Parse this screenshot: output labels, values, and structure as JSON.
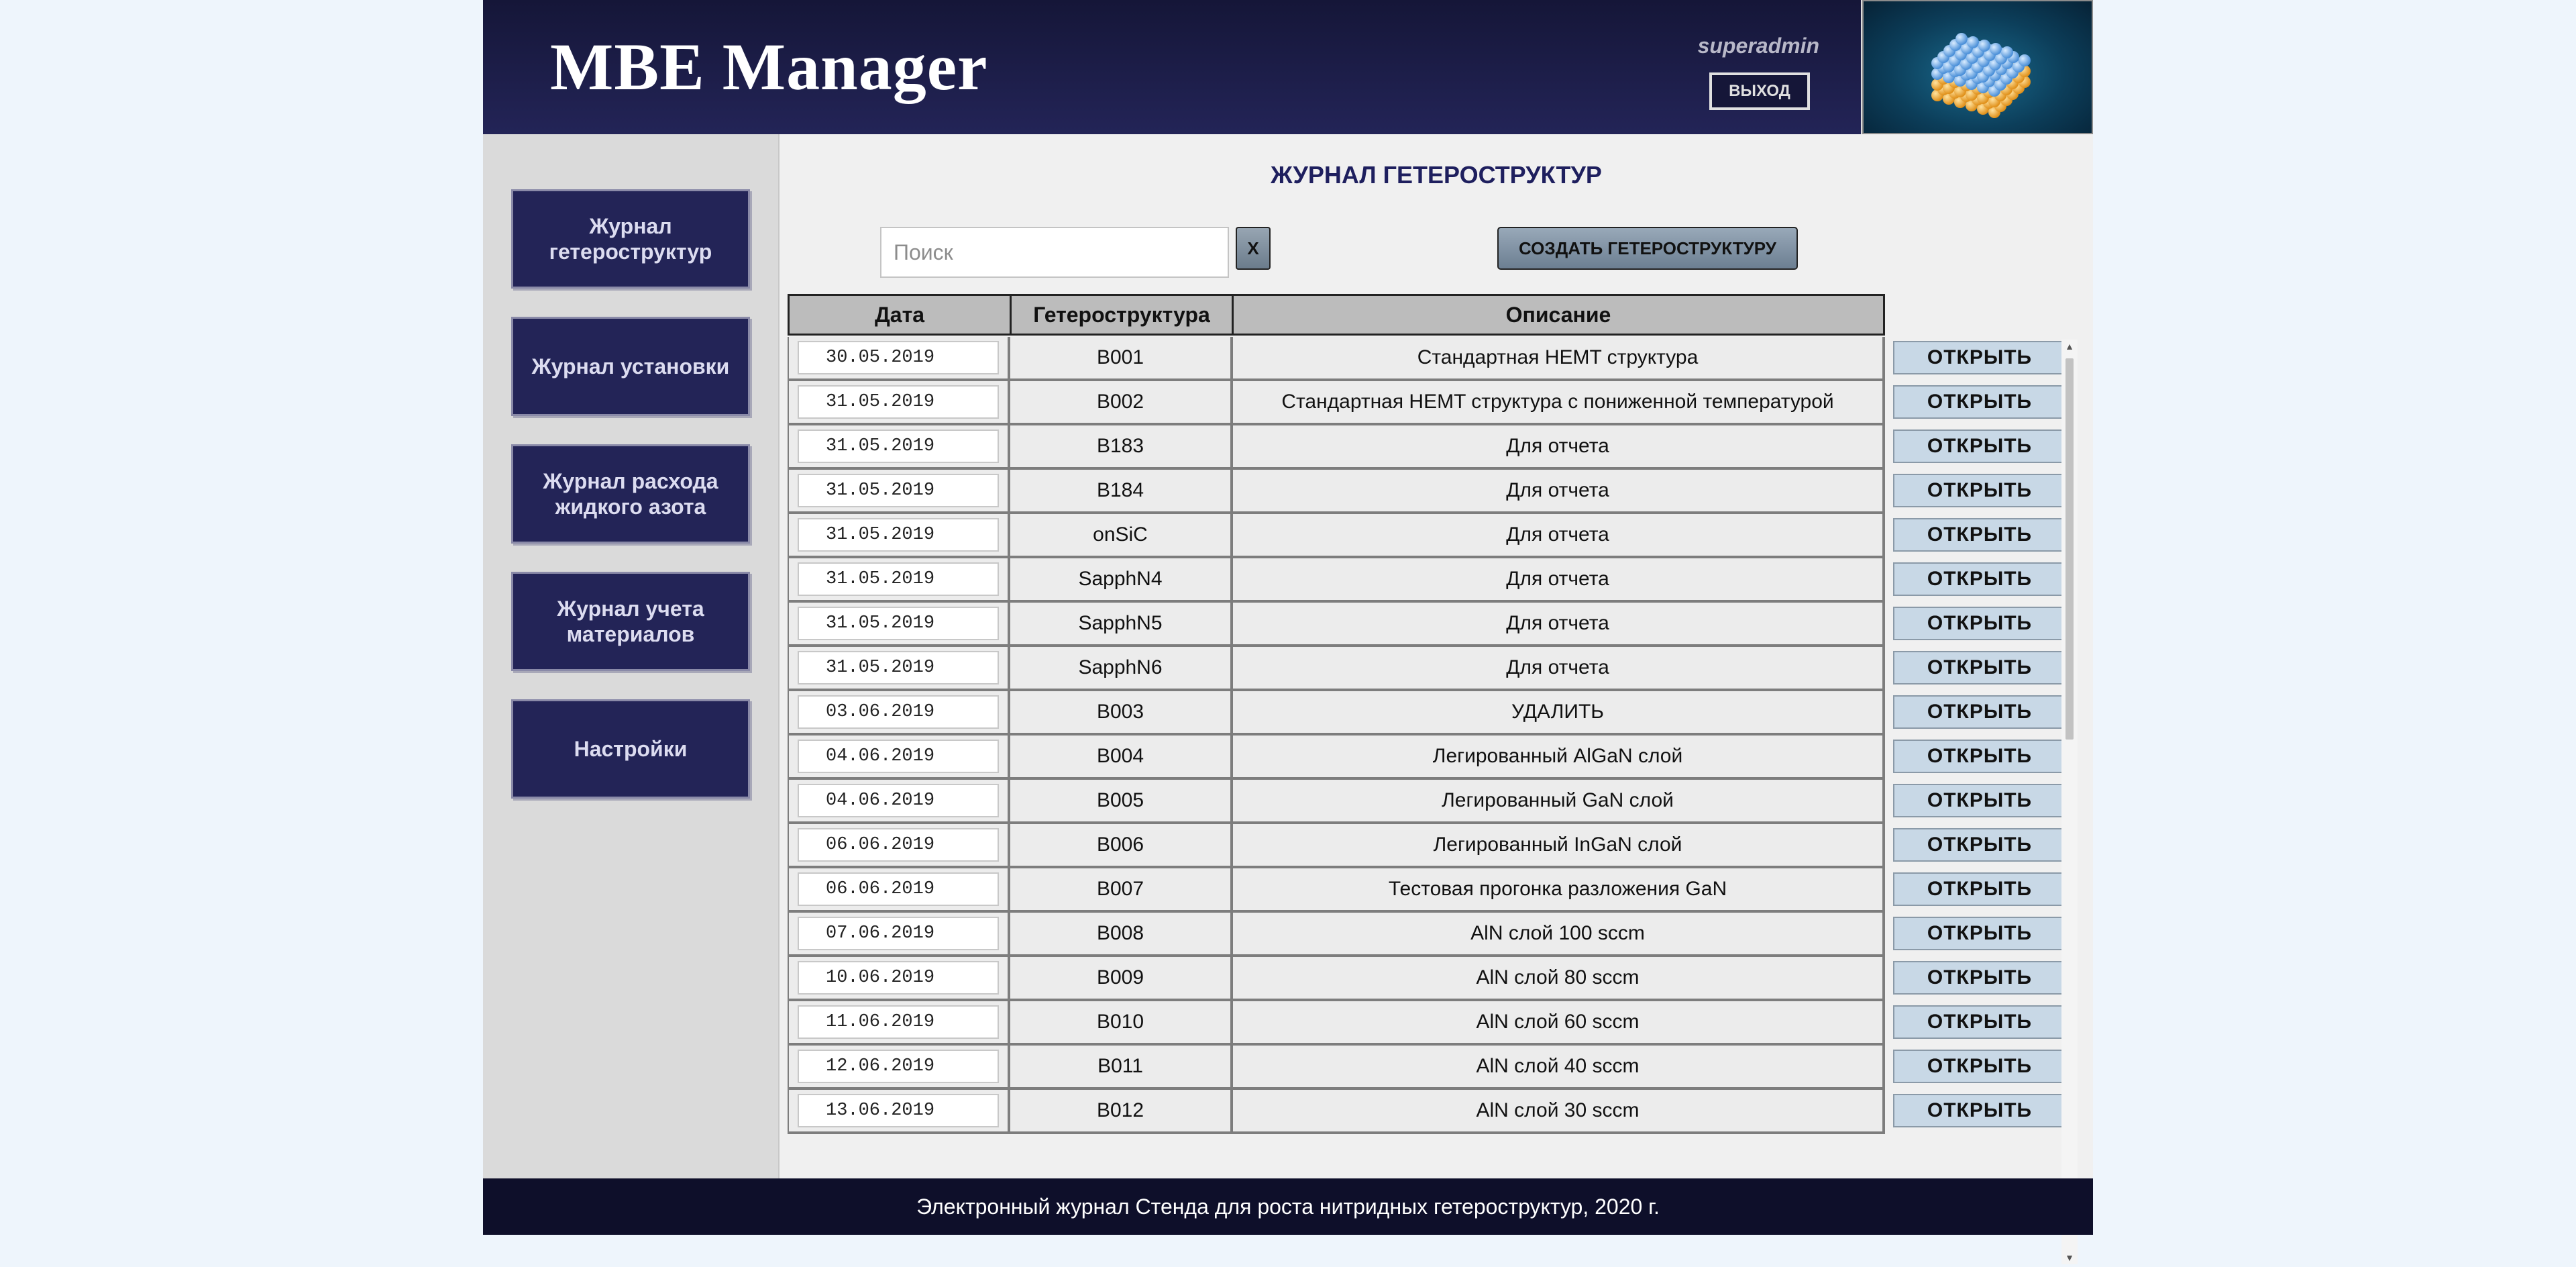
{
  "header": {
    "app_title": "MBE Manager",
    "username": "superadmin",
    "logout_label": "ВЫХОД"
  },
  "sidebar": {
    "items": [
      {
        "label": "Журнал гетероструктур"
      },
      {
        "label": "Журнал установки"
      },
      {
        "label": "Журнал расхода жидкого азота"
      },
      {
        "label": "Журнал учета материалов"
      },
      {
        "label": "Настройки"
      }
    ]
  },
  "main": {
    "title": "ЖУРНАЛ ГЕТЕРОСТРУКТУР",
    "search": {
      "placeholder": "Поиск",
      "value": ""
    },
    "clear_label": "X",
    "create_label": "СОЗДАТЬ ГЕТЕРОСТРУКТУРУ",
    "table": {
      "columns": [
        "Дата",
        "Гетероструктура",
        "Описание"
      ],
      "open_label": "ОТКРЫТЬ",
      "rows": [
        {
          "date": "30.05.2019",
          "structure": "B001",
          "description": "Стандартная HEMT структура"
        },
        {
          "date": "31.05.2019",
          "structure": "B002",
          "description": "Стандартная HEMT структура с пониженной температурой"
        },
        {
          "date": "31.05.2019",
          "structure": "B183",
          "description": "Для отчета"
        },
        {
          "date": "31.05.2019",
          "structure": "B184",
          "description": "Для отчета"
        },
        {
          "date": "31.05.2019",
          "structure": "onSiC",
          "description": "Для отчета"
        },
        {
          "date": "31.05.2019",
          "structure": "SapphN4",
          "description": "Для отчета"
        },
        {
          "date": "31.05.2019",
          "structure": "SapphN5",
          "description": "Для отчета"
        },
        {
          "date": "31.05.2019",
          "structure": "SapphN6",
          "description": "Для отчета"
        },
        {
          "date": "03.06.2019",
          "structure": "B003",
          "description": "УДАЛИТЬ"
        },
        {
          "date": "04.06.2019",
          "structure": "B004",
          "description": "Легированный AlGaN слой"
        },
        {
          "date": "04.06.2019",
          "structure": "B005",
          "description": "Легированный GaN слой"
        },
        {
          "date": "06.06.2019",
          "structure": "B006",
          "description": "Легированный InGaN слой"
        },
        {
          "date": "06.06.2019",
          "structure": "B007",
          "description": "Тестовая прогонка разложения GaN"
        },
        {
          "date": "07.06.2019",
          "structure": "B008",
          "description": "AlN слой 100 sccm"
        },
        {
          "date": "10.06.2019",
          "structure": "B009",
          "description": "AlN слой 80 sccm"
        },
        {
          "date": "11.06.2019",
          "structure": "B010",
          "description": "AlN слой 60 sccm"
        },
        {
          "date": "12.06.2019",
          "structure": "B011",
          "description": "AlN слой 40 sccm"
        },
        {
          "date": "13.06.2019",
          "structure": "B012",
          "description": "AlN слой 30 sccm"
        }
      ]
    }
  },
  "footer": {
    "text": "Электронный журнал Стенда для роста нитридных гетероструктур, 2020 г."
  },
  "colors": {
    "header_bg": "#232457",
    "nav_bg": "#232457",
    "title_color": "#1e1f5e",
    "open_button_bg": "#c8d8e6",
    "footer_bg": "#0e0f2a"
  }
}
